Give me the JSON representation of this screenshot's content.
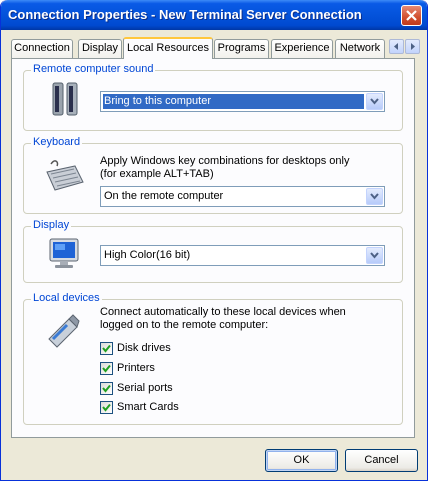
{
  "window": {
    "title": "Connection Properties - New Terminal Server Connection",
    "close_icon": "close-icon"
  },
  "tabs": [
    {
      "label": "Connection",
      "active": false
    },
    {
      "label": "Display",
      "active": false
    },
    {
      "label": "Local Resources",
      "active": true
    },
    {
      "label": "Programs",
      "active": false
    },
    {
      "label": "Experience",
      "active": false
    },
    {
      "label": "Network",
      "active": false
    }
  ],
  "tab_scroll": {
    "left_icon": "arrow-left-icon",
    "right_icon": "arrow-right-icon"
  },
  "sound": {
    "label": "Remote computer sound",
    "icon": "speakers-icon",
    "selected": "Bring to this computer"
  },
  "keyboard": {
    "label": "Keyboard",
    "icon": "keyboard-icon",
    "description_line1": "Apply Windows key combinations for desktops only",
    "description_line2": "(for example ALT+TAB)",
    "selected": "On the remote computer"
  },
  "display": {
    "label": "Display",
    "icon": "monitor-icon",
    "selected": "High Color(16 bit)"
  },
  "local_devices": {
    "label": "Local devices",
    "icon": "usb-drive-icon",
    "description_line1": "Connect automatically to these local devices when",
    "description_line2": "logged on to the remote computer:",
    "items": [
      {
        "label": "Disk drives",
        "checked": true
      },
      {
        "label": "Printers",
        "checked": true
      },
      {
        "label": "Serial ports",
        "checked": true
      },
      {
        "label": "Smart Cards",
        "checked": true
      }
    ]
  },
  "buttons": {
    "ok": "OK",
    "cancel": "Cancel"
  },
  "colors": {
    "titlebar": "#0453db",
    "group_label": "#0046d5",
    "selection": "#316ac5",
    "dialog_bg": "#ece9d8"
  }
}
